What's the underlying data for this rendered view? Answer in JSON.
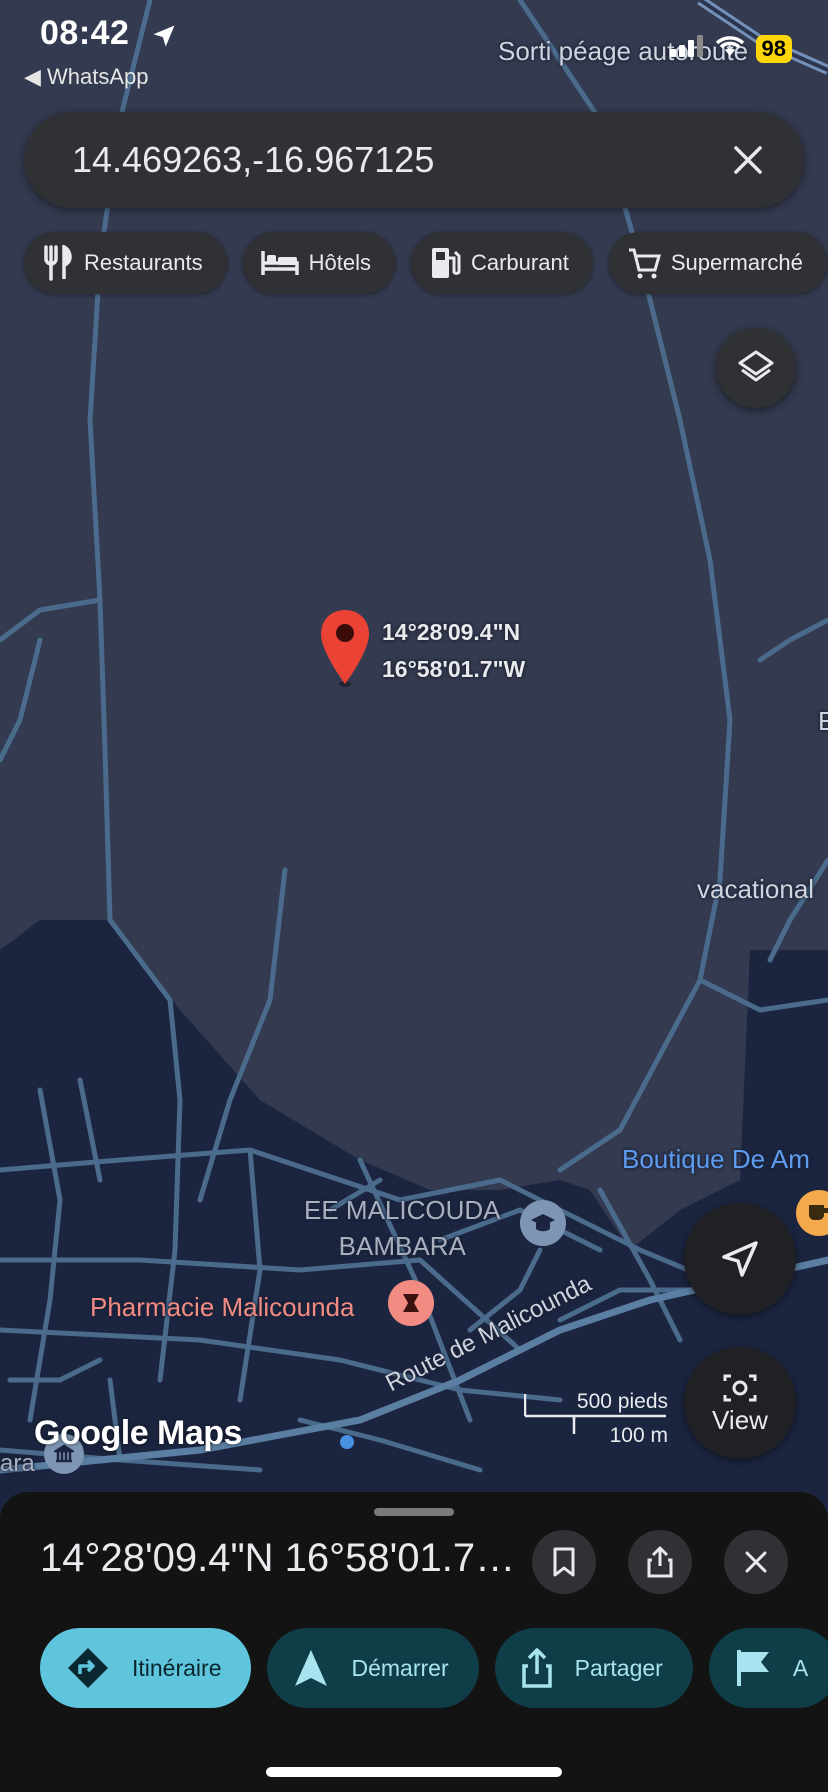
{
  "status_bar": {
    "time": "08:42",
    "back_app": "◀ WhatsApp",
    "battery": "98",
    "map_overlay_text": "Sorti péage autoroute"
  },
  "search": {
    "value": "14.469263,-16.967125"
  },
  "chips": [
    {
      "label": "Restaurants",
      "icon": "fork-knife-icon"
    },
    {
      "label": "Hôtels",
      "icon": "bed-icon"
    },
    {
      "label": "Carburant",
      "icon": "fuel-pump-icon"
    },
    {
      "label": "Supermarché",
      "icon": "cart-icon"
    }
  ],
  "pin": {
    "lat": "14°28'09.4\"N",
    "lng": "16°58'01.7\"W"
  },
  "map_labels": {
    "vacational": "vacational",
    "edge_letter": "E",
    "boutique": "Boutique De Am",
    "school": "EE MALICOUDA",
    "school_line2": "BAMBARA",
    "pharmacy": "Pharmacie Malicounda",
    "road": "Route de Malicounda",
    "left_edge": "ara"
  },
  "scale": {
    "imperial": "500 pieds",
    "metric": "100 m"
  },
  "logo": "Google Maps",
  "view_button": "View",
  "sheet": {
    "title": "14°28'09.4\"N 16°58'01.7\"W",
    "actions": [
      {
        "label": "Itinéraire"
      },
      {
        "label": "Démarrer"
      },
      {
        "label": "Partager"
      },
      {
        "label": "A"
      }
    ]
  },
  "colors": {
    "map_land": "#343a4f",
    "map_urban": "#1c2540",
    "road": "#4a6b8c",
    "pin": "#ea4335",
    "boutique_label": "#5d9cf0",
    "pharmacy_label": "#f28b82",
    "primary_action": "#5ec5dc"
  }
}
